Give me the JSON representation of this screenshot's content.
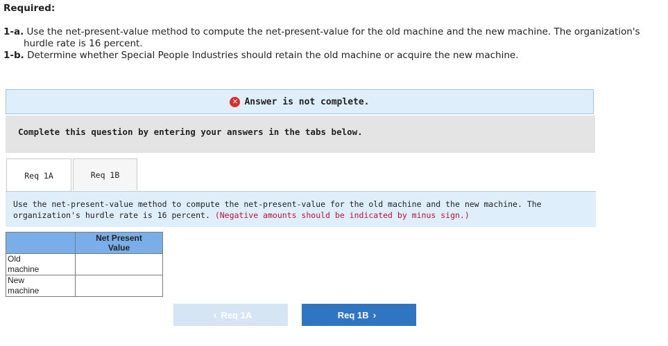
{
  "header": {
    "required_label": "Required:"
  },
  "instructions": [
    {
      "num": "1-a.",
      "line1": "Use the net-present-value method to compute the net-present-value for the old machine and the new machine. The organization's",
      "line2": "hurdle rate is 16 percent."
    },
    {
      "num": "1-b.",
      "line1": "Determine whether Special People Industries should retain the old machine or acquire the new machine."
    }
  ],
  "banner": {
    "icon": "x-circle-icon",
    "text": "Answer is not complete."
  },
  "prompt": {
    "text": "Complete this question by entering your answers in the tabs below."
  },
  "tabs": [
    {
      "label": "Req 1A",
      "active": true
    },
    {
      "label": "Req 1B",
      "active": false
    }
  ],
  "question": {
    "text": "Use the net-present-value method to compute the net-present-value for the old machine and the new machine. The organization's hurdle rate is 16 percent.",
    "note": "(Negative amounts should be indicated by minus sign.)"
  },
  "table": {
    "header_line1": "Net Present",
    "header_line2": "Value",
    "rows": [
      {
        "label_line1": "Old",
        "label_line2": "machine",
        "value": ""
      },
      {
        "label_line1": "New",
        "label_line2": "machine",
        "value": ""
      }
    ]
  },
  "nav": {
    "prev_label": "Req 1A",
    "next_label": "Req 1B",
    "prev_icon": "chevron-left-icon",
    "next_icon": "chevron-right-icon"
  },
  "colors": {
    "banner_bg": "#dfeefb",
    "table_header_bg": "#7aaee9",
    "next_button_bg": "#2f75c1",
    "prev_button_bg": "#d5e5f3",
    "note_red": "#c8102e",
    "error_red": "#d9302c"
  }
}
